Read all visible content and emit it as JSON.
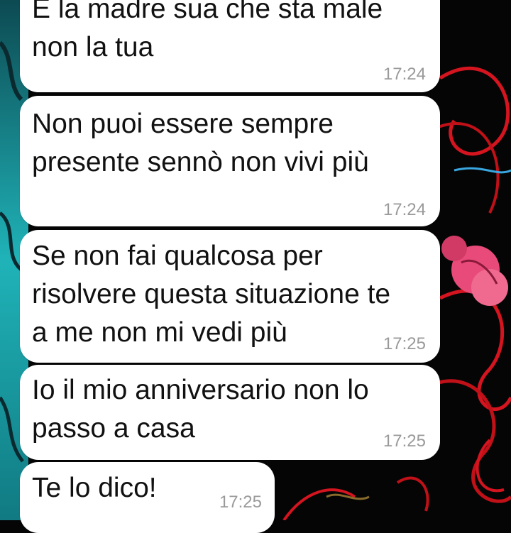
{
  "colors": {
    "bubble": "#ffffff",
    "text": "#111111",
    "time": "#9a9a9a",
    "wallpaper_teal": "#1fb3b8",
    "wallpaper_red": "#d4141f",
    "wallpaper_pink": "#e84a7a"
  },
  "messages": [
    {
      "text": "È la madre sua che sta male\nnon la tua",
      "time": "17:24"
    },
    {
      "text": "Non puoi essere sempre\npresente sennò non vivi più",
      "time": "17:24"
    },
    {
      "text": "Se non fai qualcosa per\nrisolvere questa situazione te\na me non mi vedi più",
      "time": "17:25"
    },
    {
      "text": "Io il mio anniversario non lo\npasso a casa",
      "time": "17:25"
    },
    {
      "text": "Te lo dico!",
      "time": "17:25"
    }
  ]
}
